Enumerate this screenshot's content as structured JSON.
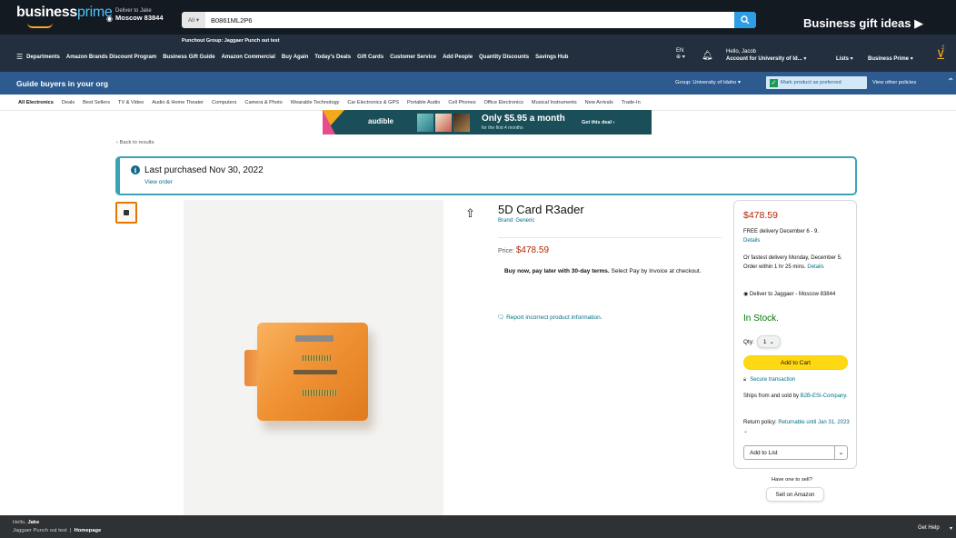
{
  "header": {
    "logo_business": "business",
    "logo_prime": "prime",
    "deliver_to": "Deliver to Jake",
    "deliver_location": "Moscow 83844",
    "search_category": "All",
    "search_value": "B0861ML2P6",
    "gift_ideas": "Business gift ideas ▶",
    "punchout_group": "Punchout Group: Jaggaer Punch out test"
  },
  "nav": {
    "links": [
      "Departments",
      "Amazon Brands Discount Program",
      "Business Gift Guide",
      "Amazon Commercial",
      "Buy Again",
      "Today's Deals",
      "Gift Cards",
      "Customer Service",
      "Add People",
      "Quantity Discounts",
      "Savings Hub"
    ],
    "lang": "EN",
    "account_greeting": "Hello, Jacob",
    "account_label": "Account for University of Id...",
    "lists": "Lists",
    "business_prime": "Business Prime",
    "cart_count": "2"
  },
  "guide": {
    "title": "Guide buyers in your org",
    "group": "Group: University of Idaho",
    "mark_preferred": "Mark product as preferred",
    "view_policies": "View other policies"
  },
  "categories": [
    "All Electronics",
    "Deals",
    "Best Sellers",
    "TV & Video",
    "Audio & Home Theater",
    "Computers",
    "Camera & Photo",
    "Wearable Technology",
    "Car Electronics & GPS",
    "Portable Audio",
    "Cell Phones",
    "Office Electronics",
    "Musical Instruments",
    "New Arrivals",
    "Trade-In"
  ],
  "banner": {
    "brand": "audible",
    "offer": "Only $5.95 a month",
    "offer_sub": "for the first 4 months",
    "cta": "Get this deal ›"
  },
  "page": {
    "back": "‹ Back to results",
    "last_purchased": "Last purchased Nov 30, 2022",
    "view_order": "View order"
  },
  "product": {
    "title": "5D Card R3ader",
    "brand": "Brand: Generic",
    "price_label": "Price:",
    "price": "$478.59",
    "paylater_bold": "Buy now, pay later with 30-day terms.",
    "paylater_rest": "Select Pay by Invoice at checkout.",
    "report": "Report incorrect product information."
  },
  "buybox": {
    "price": "$478.59",
    "free_delivery": "FREE delivery December 6 - 9.",
    "details": "Details",
    "fastest": "Or fastest delivery Monday, December 5. Order within 1 hr 25 mins.",
    "deliver_to": "Deliver to Jaggaer - Moscow 83844",
    "stock": "In Stock.",
    "qty_label": "Qty:",
    "qty_value": "1",
    "add_to_cart": "Add to Cart",
    "secure": "Secure transaction",
    "ships_prefix": "Ships from and sold by",
    "seller": "B2B-ESI-Company.",
    "return_prefix": "Return policy:",
    "return_link": "Returnable until Jan 31, 2023",
    "add_to_list": "Add to List"
  },
  "sell": {
    "have_one": "Have one to sell?",
    "button": "Sell on Amazon"
  },
  "footer": {
    "hello": "Hello,",
    "user": "Jake",
    "punchout": "Jaggaer Punch out test",
    "homepage": "Homepage",
    "help": "Get Help"
  }
}
